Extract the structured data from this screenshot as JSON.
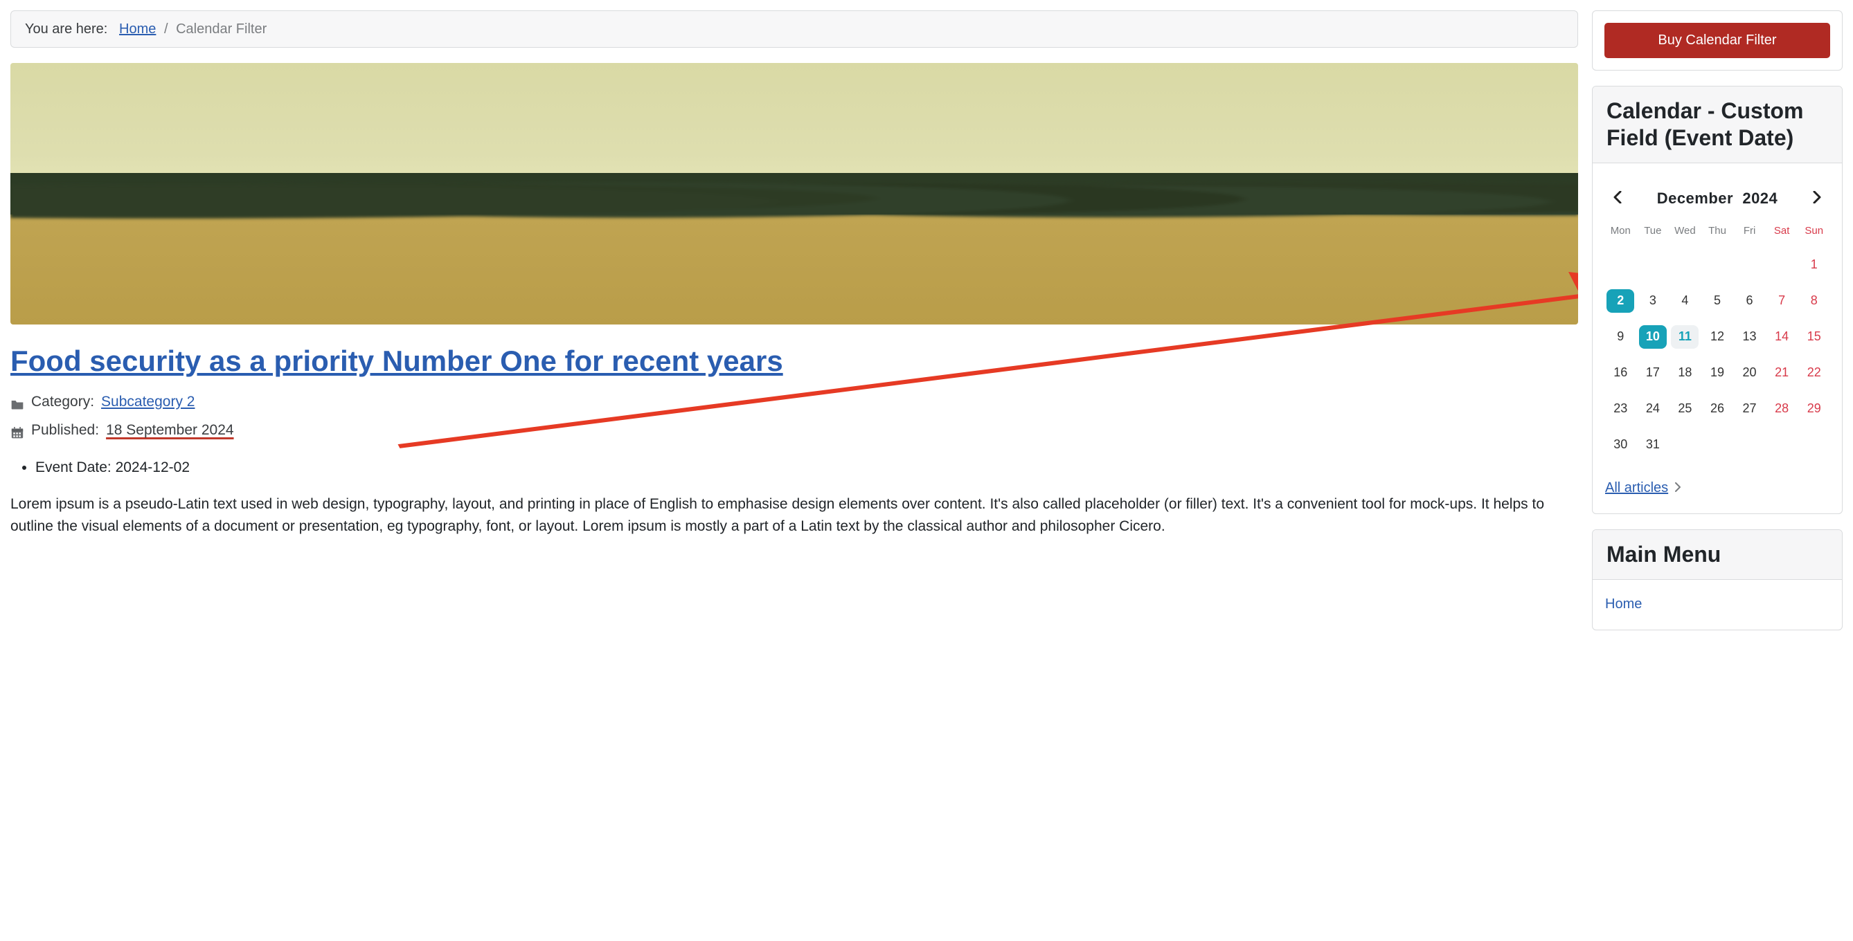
{
  "breadcrumb": {
    "you_are_here": "You are here:",
    "home_label": "Home",
    "separator": "/",
    "current": "Calendar Filter"
  },
  "article": {
    "title": "Food security as a priority Number One for recent years",
    "category_label": "Category:",
    "category_link": "Subcategory 2",
    "published_label": "Published:",
    "published_date": "18 September 2024",
    "event_date_label": "Event Date:",
    "event_date_value": "2024-12-02",
    "body": "Lorem ipsum is a pseudo-Latin text used in web design, typography, layout, and printing in place of English to emphasise design elements over content. It's also called placeholder (or filler) text. It's a convenient tool for mock-ups. It helps to outline the visual elements of a document or presentation, eg typography, font, or layout. Lorem ipsum is mostly a part of a Latin text by the classical author and philosopher Cicero."
  },
  "sidebar": {
    "buy_button": "Buy Calendar Filter",
    "calendar_card_title": "Calendar - Custom Field (Event Date)",
    "calendar": {
      "month": "December",
      "year": "2024",
      "dow": [
        "Mon",
        "Tue",
        "Wed",
        "Thu",
        "Fri",
        "Sat",
        "Sun"
      ],
      "weeks": [
        [
          {
            "d": ""
          },
          {
            "d": ""
          },
          {
            "d": ""
          },
          {
            "d": ""
          },
          {
            "d": ""
          },
          {
            "d": ""
          },
          {
            "d": "1",
            "wknd": true
          }
        ],
        [
          {
            "d": "2",
            "sel": true
          },
          {
            "d": "3"
          },
          {
            "d": "4"
          },
          {
            "d": "5"
          },
          {
            "d": "6"
          },
          {
            "d": "7",
            "wknd": true
          },
          {
            "d": "8",
            "wknd": true
          }
        ],
        [
          {
            "d": "9"
          },
          {
            "d": "10",
            "sel": true
          },
          {
            "d": "11",
            "hl": true
          },
          {
            "d": "12"
          },
          {
            "d": "13"
          },
          {
            "d": "14",
            "wknd": true
          },
          {
            "d": "15",
            "wknd": true
          }
        ],
        [
          {
            "d": "16"
          },
          {
            "d": "17"
          },
          {
            "d": "18"
          },
          {
            "d": "19"
          },
          {
            "d": "20"
          },
          {
            "d": "21",
            "wknd": true
          },
          {
            "d": "22",
            "wknd": true
          }
        ],
        [
          {
            "d": "23"
          },
          {
            "d": "24"
          },
          {
            "d": "25"
          },
          {
            "d": "26"
          },
          {
            "d": "27"
          },
          {
            "d": "28",
            "wknd": true
          },
          {
            "d": "29",
            "wknd": true
          }
        ],
        [
          {
            "d": "30"
          },
          {
            "d": "31"
          },
          {
            "d": ""
          },
          {
            "d": ""
          },
          {
            "d": ""
          },
          {
            "d": ""
          },
          {
            "d": ""
          }
        ]
      ],
      "all_articles_label": "All articles"
    },
    "main_menu_title": "Main Menu",
    "main_menu_items": [
      "Home"
    ]
  }
}
